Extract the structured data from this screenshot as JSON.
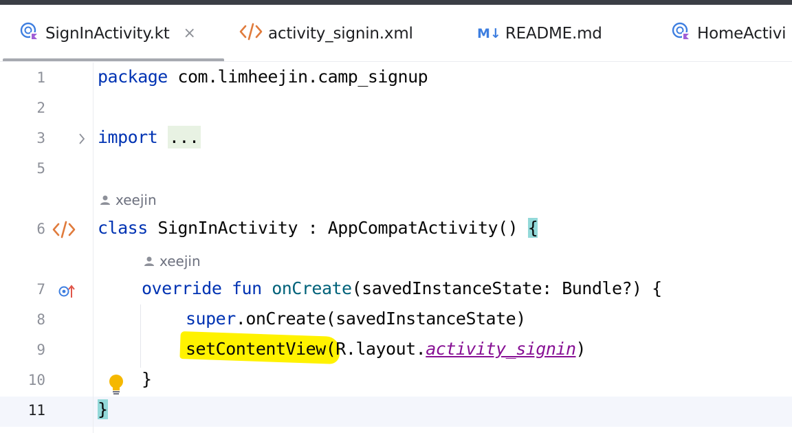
{
  "tabs": [
    {
      "label": "SignInActivity.kt",
      "icon": "kotlin-class-icon",
      "active": true,
      "close": "×"
    },
    {
      "label": "activity_signin.xml",
      "icon": "xml-icon"
    },
    {
      "label": "README.md",
      "icon": "markdown-icon",
      "icon_text": "M↓"
    },
    {
      "label": "HomeActivi",
      "icon": "kotlin-class-icon"
    }
  ],
  "gutter": {
    "line_numbers": [
      "1",
      "2",
      "3",
      "5",
      "6",
      "7",
      "8",
      "9",
      "10",
      "11"
    ],
    "current_line": "11"
  },
  "code": {
    "l1_kw": "package",
    "l1_rest": " com.limheejin.camp_signup",
    "l3_kw": "import",
    "l3_fold": "...",
    "author1": "xeejin",
    "l6_kw": "class",
    "l6_rest": " SignInActivity : AppCompatActivity() ",
    "l6_brace": "{",
    "author2": "xeejin",
    "l7_kw1": "override",
    "l7_kw2": "fun",
    "l7_fn": "onCreate",
    "l7_rest": "(savedInstanceState: Bundle?) {",
    "l8_kw": "super",
    "l8_rest": ".onCreate(savedInstanceState)",
    "l9_call": "setContentView",
    "l9_mid": "(R.layout.",
    "l9_ref": "activity_signin",
    "l9_end": ")",
    "l10": "}",
    "l11": "}"
  },
  "colors": {
    "keyword": "#0033b3",
    "function": "#00627a",
    "resource_ref": "#871094",
    "highlighter": "#fff200",
    "brace_match": "#93d9d9"
  }
}
